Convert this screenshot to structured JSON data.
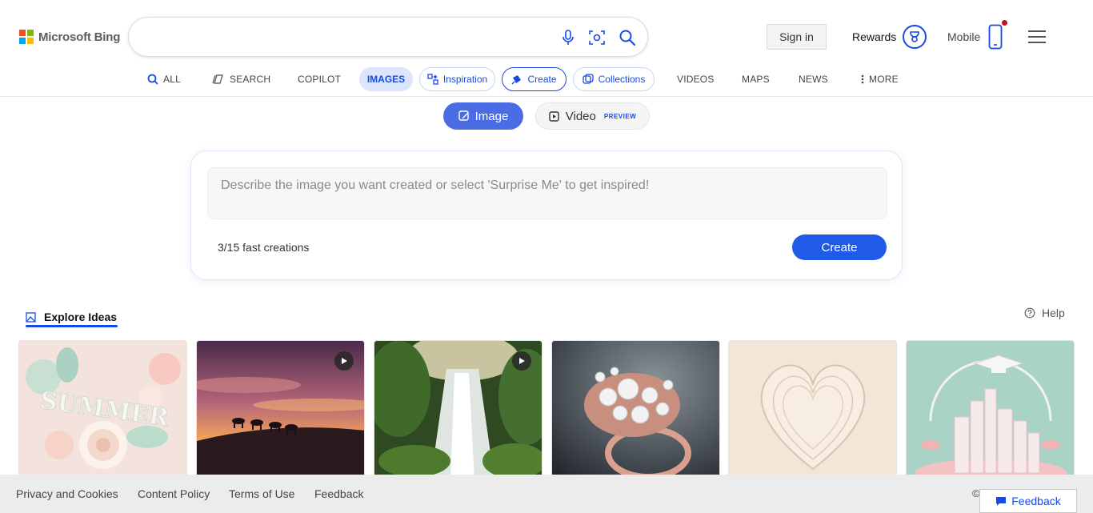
{
  "brand": {
    "name": "Microsoft Bing",
    "logo_colors": [
      "#f25022",
      "#7fba00",
      "#00a4ef",
      "#ffb900"
    ]
  },
  "search": {
    "value": "",
    "placeholder": "",
    "icons": [
      "microphone-icon",
      "visual-search-icon",
      "search-icon"
    ]
  },
  "header": {
    "sign_in": "Sign in",
    "rewards_label": "Rewards",
    "mobile_label": "Mobile",
    "notification_dot_color": "#c50f1f"
  },
  "nav": {
    "all": "ALL",
    "search": "SEARCH",
    "copilot": "COPILOT",
    "images": "IMAGES",
    "inspiration": "Inspiration",
    "create": "Create",
    "collections": "Collections",
    "videos": "VIDEOS",
    "maps": "MAPS",
    "news": "NEWS",
    "more": "MORE"
  },
  "mode_toggle": {
    "image": "Image",
    "video": "Video",
    "video_tag": "PREVIEW",
    "selected": "Image"
  },
  "creator": {
    "prompt_placeholder": "Describe the image you want created or select 'Surprise Me' to get inspired!",
    "prompt_value": "",
    "fast_creations": "3/15 fast creations",
    "create_button": "Create"
  },
  "explore": {
    "tab_label": "Explore Ideas",
    "help_label": "Help",
    "items": [
      {
        "subject": "paper-craft summer floral lettering",
        "video": false
      },
      {
        "subject": "camel caravan silhouette at sunset",
        "video": true
      },
      {
        "subject": "forest waterfall",
        "video": true
      },
      {
        "subject": "rose gold pearl ring",
        "video": false
      },
      {
        "subject": "paper quilling heart",
        "video": false
      },
      {
        "subject": "pastel paper city with graduation cap",
        "video": false
      }
    ]
  },
  "footer": {
    "privacy": "Privacy and Cookies",
    "content_policy": "Content Policy",
    "terms": "Terms of Use",
    "feedback": "Feedback",
    "copyright": "©",
    "feedback_button": "Feedback"
  },
  "colors": {
    "accent": "#174ae4",
    "toggle_active": "#4a6de5",
    "create_button": "#1f5ae8",
    "images_pill_bg": "#dbe5fb",
    "footer_bg": "#ececec"
  }
}
